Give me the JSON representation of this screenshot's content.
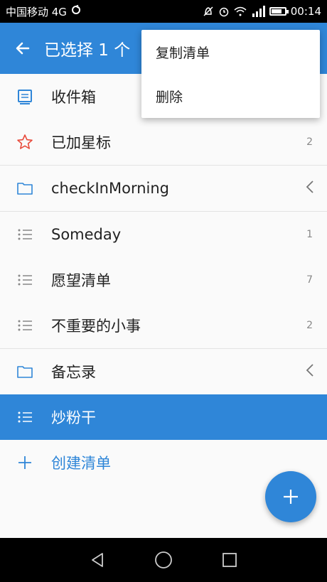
{
  "status_bar": {
    "carrier": "中国移动 4G",
    "time": "00:14"
  },
  "app_bar": {
    "title": "已选择 1 个"
  },
  "menu": {
    "items": [
      {
        "label": "复制清单"
      },
      {
        "label": "删除"
      }
    ]
  },
  "lists": {
    "items": [
      {
        "label": "收件箱",
        "count": "",
        "icon": "inbox-icon"
      },
      {
        "label": "已加星标",
        "count": "2",
        "icon": "star-icon"
      },
      {
        "label": "checkInMorning",
        "count": "",
        "icon": "folder-icon"
      },
      {
        "label": "Someday",
        "count": "1",
        "icon": "list-icon"
      },
      {
        "label": "愿望清单",
        "count": "7",
        "icon": "list-icon"
      },
      {
        "label": "不重要的小事",
        "count": "2",
        "icon": "list-icon"
      },
      {
        "label": "备忘录",
        "count": "",
        "icon": "folder-icon"
      },
      {
        "label": "炒粉干",
        "count": "",
        "icon": "list-icon"
      }
    ],
    "create_label": "创建清单"
  },
  "colors": {
    "accent": "#2f86d8",
    "star": "#e84a3b"
  }
}
